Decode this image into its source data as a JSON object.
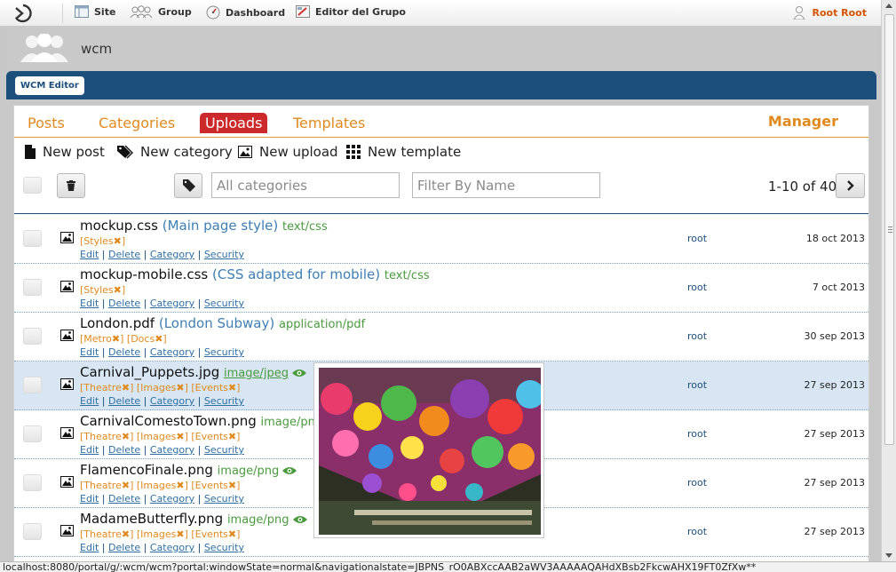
{
  "topbar": {
    "nav": [
      {
        "label": "Site",
        "icon": "site-icon"
      },
      {
        "label": "Group",
        "icon": "group-icon"
      },
      {
        "label": "Dashboard",
        "icon": "dashboard-icon"
      },
      {
        "label": "Editor del Grupo",
        "icon": "editor-icon"
      }
    ],
    "user": "Root Root"
  },
  "group": {
    "name": "wcm"
  },
  "portlet": {
    "tab": "WCM Editor"
  },
  "tabs": [
    "Posts",
    "Categories",
    "Uploads",
    "Templates"
  ],
  "active_tab": "Uploads",
  "manager": "Manager",
  "actions": [
    "New post",
    "New category",
    "New upload",
    "New template"
  ],
  "filters": {
    "categories_placeholder": "All categories",
    "name_placeholder": "Filter By Name"
  },
  "pager": "1-10 of 40",
  "item_links": [
    "Edit",
    "Delete",
    "Category",
    "Security"
  ],
  "rows": [
    {
      "name": "mockup.css",
      "desc": "(Main page style)",
      "mime": "text/css",
      "cats": [
        "Styles"
      ],
      "owner": "root",
      "date": "18 oct 2013"
    },
    {
      "name": "mockup-mobile.css",
      "desc": "(CSS adapted for mobile)",
      "mime": "text/css",
      "cats": [
        "Styles"
      ],
      "owner": "root",
      "date": "7 oct 2013"
    },
    {
      "name": "London.pdf",
      "desc": "(London Subway)",
      "mime": "application/pdf",
      "cats": [
        "Metro",
        "Docs"
      ],
      "owner": "root",
      "date": "30 sep 2013"
    },
    {
      "name": "Carnival_Puppets.jpg",
      "desc": "",
      "mime": "image/jpeg",
      "cats": [
        "Theatre",
        "Images",
        "Events"
      ],
      "owner": "root",
      "date": "27 sep 2013"
    },
    {
      "name": "CarnivalComestoTown.png",
      "desc": "",
      "mime": "image/png",
      "cats": [
        "Theatre",
        "Images",
        "Events"
      ],
      "owner": "root",
      "date": "27 sep 2013"
    },
    {
      "name": "FlamencoFinale.png",
      "desc": "",
      "mime": "image/png",
      "cats": [
        "Theatre",
        "Images",
        "Events"
      ],
      "owner": "root",
      "date": "27 sep 2013"
    },
    {
      "name": "MadameButterfly.png",
      "desc": "",
      "mime": "image/png",
      "cats": [
        "Theatre",
        "Images",
        "Events"
      ],
      "owner": "root",
      "date": "27 sep 2013"
    }
  ],
  "status_url": "localhost:8080/portal/g/:wcm/wcm?portal:windowState=normal&navigationalstate=JBPNS_rO0ABXccAAB2aWV3AAAAAQAHdXBsb2FkcwAHX19FT0ZfXw**"
}
